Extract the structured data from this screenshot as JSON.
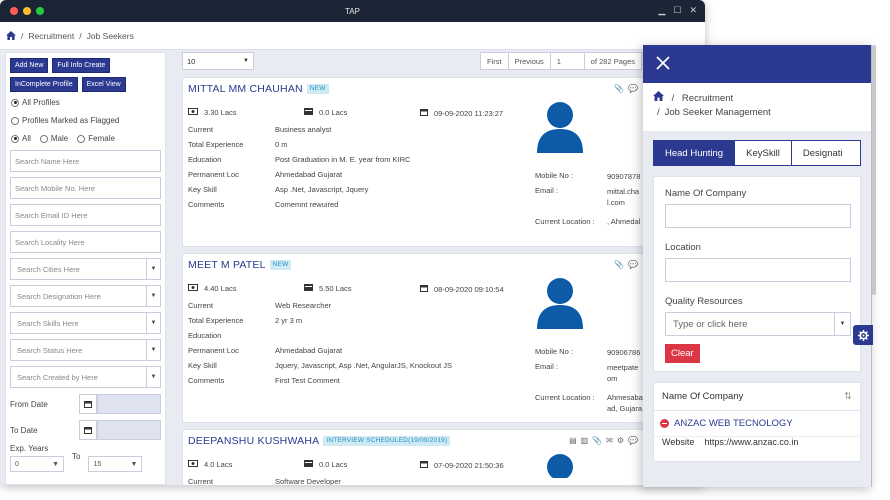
{
  "window": {
    "title": "TAP",
    "dots": [
      "#ff5f57",
      "#febc2e",
      "#28c840"
    ]
  },
  "breadcrumb": {
    "items": [
      "Recruitment",
      "Job Seekers"
    ],
    "sep": "/"
  },
  "filters": {
    "buttons": [
      "Add New",
      "Full Info Create",
      "InComplete Profile",
      "Excel View"
    ],
    "radio_all_profiles": "All Profiles",
    "radio_flagged": "Profiles Marked as Flagged",
    "gender": [
      "All",
      "Male",
      "Female"
    ],
    "text_fields": [
      "Search Name Here",
      "Search Mobile No. Here",
      "Search Email ID Here",
      "Search Locality Here"
    ],
    "select_fields": [
      "Search Cities Here",
      "Search Designation Here",
      "Search Skills Here",
      "Search Status Here",
      "Search Created by Here"
    ],
    "from_date": "From Date",
    "to_date": "To Date",
    "exp_years": "Exp. Years",
    "to": "To",
    "exp_from": "0",
    "exp_to": "15"
  },
  "pager": {
    "page_size": "10",
    "first": "First",
    "previous": "Previous",
    "page": "1",
    "total": "of 282 Pages"
  },
  "cards": [
    {
      "name": "MITTAL MM CHAUHAN",
      "badge": "NEW",
      "ctc": "3.30 Lacs",
      "ectc": "0.0 Lacs",
      "date": "09-09-2020 11:23:27",
      "labels": [
        "Current",
        "Total Experience",
        "Education",
        "Permanent Loc",
        "Key Skill",
        "Comments"
      ],
      "values": [
        "Business analyst",
        "0 m",
        "Post Graduation in M. E. year from KIRC",
        "Ahmedabad Gujarat",
        "Asp .Net, Javascript, Jquery",
        "Comemnt rewuired"
      ],
      "mobile_label": "Mobile No :",
      "mobile": "90907878",
      "email_label": "Email :",
      "email": "mittal.cha l.com",
      "location_label": "Current Location :",
      "location": ", Ahmedal"
    },
    {
      "name": "MEET M PATEL",
      "badge": "NEW",
      "ctc": "4.40 Lacs",
      "ectc": "5.50 Lacs",
      "date": "08-09-2020 09:10:54",
      "labels": [
        "Current",
        "Total Experience",
        "Education",
        "Permanent Loc",
        "Key Skill",
        "Comments"
      ],
      "values": [
        "Web Researcher",
        "2 yr 3 m",
        "",
        "Ahmedabad Gujarat",
        "Jquery, Javascript, Asp .Net, AngularJS, Knockout JS",
        "First Test Comment"
      ],
      "mobile_label": "Mobile No :",
      "mobile": "90906786",
      "email_label": "Email :",
      "email": "meetpate om",
      "location_label": "Current Location :",
      "location": "Ahmesaba ad, Gujara"
    },
    {
      "name": "DEEPANSHU KUSHWAHA",
      "badge": "INTERVIEW SCHEDULED(19/09/2019)",
      "ctc": "4.0 Lacs",
      "ectc": "0.0 Lacs",
      "date": "07-09-2020 21:50:36",
      "labels": [
        "Current"
      ],
      "values": [
        "Software Developer"
      ]
    }
  ],
  "panel": {
    "breadcrumb_1": "Recruitment",
    "breadcrumb_2": "Job Seeker Management",
    "tabs": [
      "Head Hunting",
      "KeySkill",
      "Designati"
    ],
    "company_label": "Name Of Company",
    "location_label": "Location",
    "quality_label": "Quality Resources",
    "quality_placeholder": "Type or click here",
    "clear": "Clear",
    "result_header": "Name Of Company",
    "result_company": "ANZAC WEB TECNOLOGY",
    "website_label": "Website",
    "website_value": "https://www.anzac.co.in"
  },
  "colors": {
    "brand": "#2b3990",
    "danger": "#dc3545",
    "badge_bg": "#cdeaf5"
  }
}
